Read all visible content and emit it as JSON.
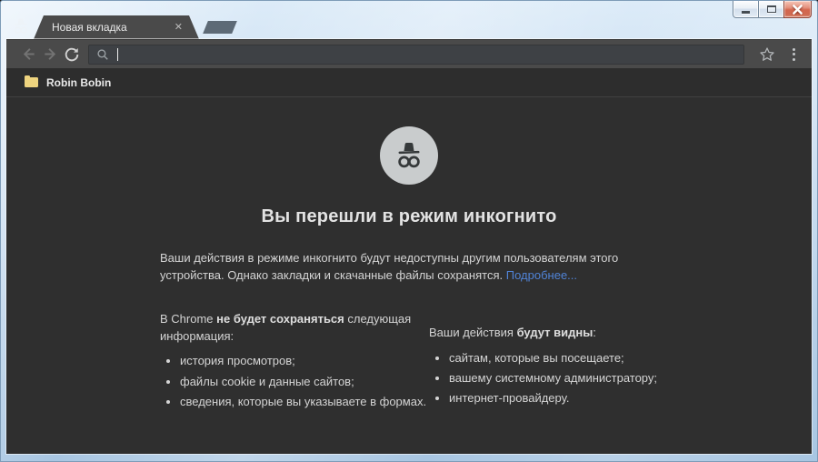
{
  "tab": {
    "title": "Новая вкладка"
  },
  "icons": {
    "incognito_badge": "spy-hat-and-glasses",
    "tab_close": "✕",
    "new_tab_button": "parallelogram",
    "back": "left-arrow",
    "forward": "right-arrow",
    "reload": "circular-arrow",
    "search": "magnifier",
    "star": "star-outline",
    "menu": "three-vertical-dots",
    "bookmark_folder": "yellow-folder",
    "minimize": "dash",
    "maximize": "square",
    "close": "x"
  },
  "address_bar": {
    "value": "",
    "placeholder": ""
  },
  "bookmarks_bar": {
    "items": [
      {
        "label": "Robin Bobin"
      }
    ]
  },
  "incognito_page": {
    "heading": "Вы перешли в режим инкогнито",
    "intro": "Ваши действия в режиме инкогнито будут недоступны другим пользователям этого устройства. Однако закладки и скачанные файлы сохранятся.",
    "learn_more": "Подробнее...",
    "left_column": {
      "header_pre": "В Chrome ",
      "header_bold": "не будет сохраняться",
      "header_post": " следующая информация:",
      "items": [
        "история просмотров;",
        "файлы cookie и данные сайтов;",
        "сведения, которые вы указываете в формах."
      ]
    },
    "right_column": {
      "header_pre": "Ваши действия ",
      "header_bold": "будут видны",
      "header_post": ":",
      "items": [
        "сайтам, которые вы посещаете;",
        "вашему системному администратору;",
        "интернет-провайдеру."
      ]
    }
  },
  "colors": {
    "frame_glass": "#b9d1e8",
    "toolbar": "#4a4a4a",
    "address_bar": "#3e4145",
    "bookmarks_bg": "#2d2d2d",
    "content_bg": "#2f2f2f",
    "link": "#5083d6",
    "close_button_red": "#cf6a52",
    "folder_yellow": "#eed47f",
    "spy_circle": "#c9cccd"
  }
}
